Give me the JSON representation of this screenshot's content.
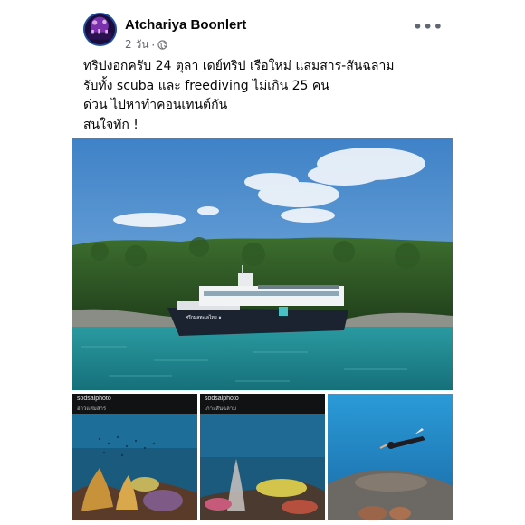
{
  "post": {
    "author": "Atchariya Boonlert",
    "time": "2 วัน",
    "separator": "·",
    "more_label": "•••",
    "text_lines": [
      "ทริปงอกครับ 24 ตุลา เดย์ทริป เรือใหม่ แสมสาร-สันฉลาม",
      "รับทั้ง scuba และ freediving ไม่เกิน 25 คน",
      "ด่วน ไปหาทำคอนเทนต์กัน",
      "สนใจทัก !"
    ]
  },
  "main_photo": {
    "boat_name": "ศรีกมลทะเลไทย ๑"
  },
  "thumbnails": [
    {
      "watermark": "sodsaiphoto",
      "place": "อ่าวแสมสาร"
    },
    {
      "watermark": "sodsaiphoto",
      "place": "เกาะสันฉลาม"
    },
    {
      "watermark": "",
      "place": ""
    }
  ],
  "icons": {
    "privacy": "globe-icon",
    "menu": "more-icon"
  },
  "colors": {
    "name_text": "#050505",
    "meta_text": "#65676b",
    "sky": "#5e9ad6",
    "sea": "#1f8c8f"
  }
}
